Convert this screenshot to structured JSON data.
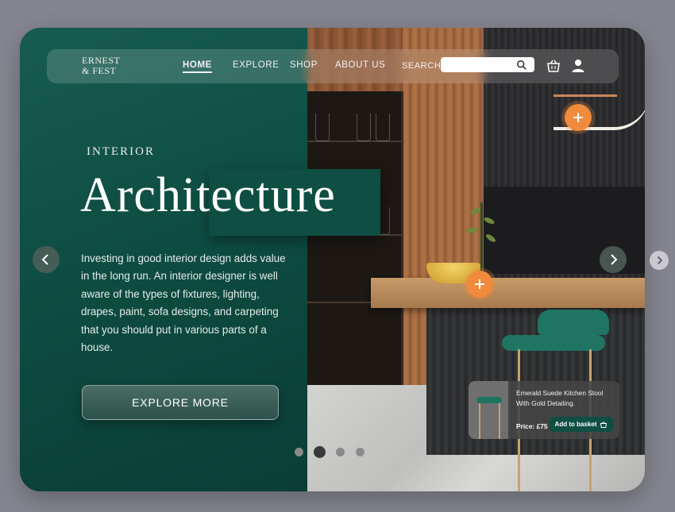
{
  "brand": {
    "line1": "ERNEST",
    "line2": "& FEST"
  },
  "nav": {
    "items": [
      {
        "label": "HOME",
        "active": true
      },
      {
        "label": "EXPLORE",
        "active": false
      },
      {
        "label": "SHOP",
        "active": false
      },
      {
        "label": "ABOUT US",
        "active": false
      }
    ],
    "search_label": "SEARCH",
    "search_value": ""
  },
  "hero": {
    "eyebrow": "INTERIOR",
    "title": "Architecture",
    "body": "Investing in good interior design adds value in the long run. An interior designer is well aware of the types of fixtures, lighting, drapes, paint, sofa designs, and carpeting that you should put in various parts of a house.",
    "cta_label": "EXPLORE MORE"
  },
  "product": {
    "name": "Emerald Suede Kitchen Stool With Gold Detailing.",
    "price": "Price: £75",
    "add_label": "Add to basket"
  },
  "slider": {
    "total": 4,
    "active": 2
  },
  "colors": {
    "accent": "#f08a3c",
    "brand_green": "#0f4d42",
    "stool_green": "#1f7462"
  },
  "icons": [
    "search-icon",
    "basket-icon",
    "user-icon",
    "plus-icon",
    "chevron-left-icon",
    "chevron-right-icon"
  ]
}
